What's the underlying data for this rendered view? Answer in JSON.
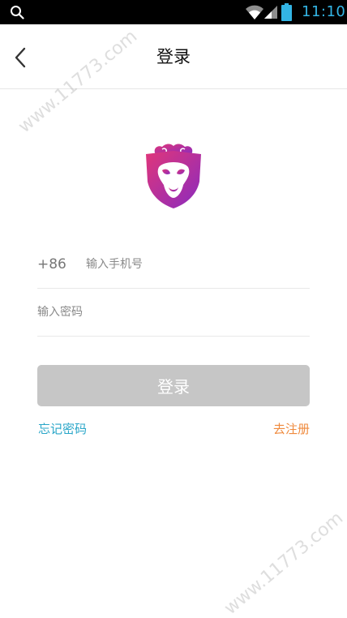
{
  "status_bar": {
    "time": "11:10",
    "icons": [
      "search-icon",
      "wifi-icon",
      "signal-icon",
      "battery-icon"
    ],
    "time_color": "#33b5e5"
  },
  "nav": {
    "title": "登录",
    "back_icon": "chevron-left-icon"
  },
  "logo": {
    "icon": "monkey-shield-logo",
    "colors": [
      "#e0367a",
      "#8a2bbf"
    ]
  },
  "form": {
    "phone_prefix": "+86",
    "phone_placeholder": "输入手机号",
    "password_placeholder": "输入密码"
  },
  "actions": {
    "login_label": "登录",
    "forgot_label": "忘记密码",
    "register_label": "去注册",
    "forgot_color": "#29a6c8",
    "register_color": "#ef8a3d",
    "login_bg": "#c6c6c6"
  },
  "watermark": {
    "text": "www.11773.com"
  }
}
